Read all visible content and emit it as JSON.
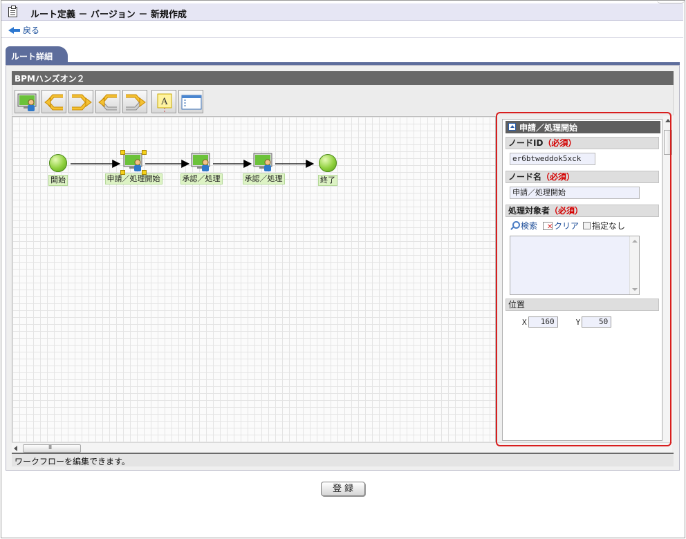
{
  "header": {
    "title": "ルート定義 － バージョン － 新規作成"
  },
  "nav": {
    "back_label": "戻る"
  },
  "tabs": [
    {
      "label": "ルート詳細"
    }
  ],
  "editor": {
    "route_name": "BPMハンズオン２",
    "toolbar_items": [
      "user-node-tool",
      "branch-tool",
      "join-tool",
      "branch-alt-tool",
      "join-alt-tool",
      "text-note-tool",
      "window-tool"
    ],
    "status_text": "ワークフローを編集できます。"
  },
  "workflow": {
    "nodes": [
      {
        "id": "start",
        "label": "開始",
        "type": "start"
      },
      {
        "id": "apply",
        "label": "申請／処理開始",
        "type": "user",
        "selected": true
      },
      {
        "id": "approve1",
        "label": "承認／処理",
        "type": "user"
      },
      {
        "id": "approve2",
        "label": "承認／処理",
        "type": "user"
      },
      {
        "id": "end",
        "label": "終了",
        "type": "end"
      }
    ]
  },
  "properties": {
    "panel_title": "申請／処理開始",
    "node_id_label": "ノードID",
    "node_id_value": "er6btweddok5xck",
    "node_name_label": "ノード名",
    "node_name_value": "申請／処理開始",
    "target_label": "処理対象者",
    "required_text": "（必須）",
    "search_label": "検索",
    "clear_label": "クリア",
    "unspecified_label": "指定なし",
    "position_label": "位置",
    "x_label": "X",
    "x_value": "160",
    "y_label": "Y",
    "y_value": "50"
  },
  "footer": {
    "register_label": "登録"
  },
  "colors": {
    "accent": "#5d6d9c",
    "required": "#d40000",
    "highlight_border": "#d81e1e",
    "node_label_bg": "#ddf3c4"
  }
}
